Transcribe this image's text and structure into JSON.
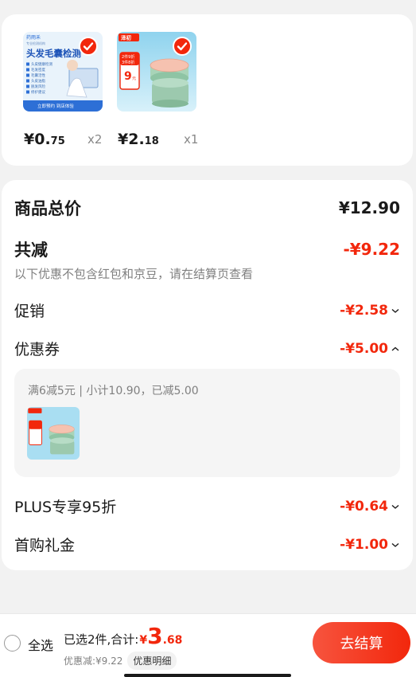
{
  "products": [
    {
      "image_text": {
        "brand": "药雨禾",
        "sub": "专业检测机构",
        "headline": "头发毛囊检测",
        "bullets": [
          "头皮健康检测",
          "毛发密度",
          "毛囊活性",
          "头皮油脂",
          "脱发风险",
          "修护建议"
        ],
        "footer": "立即预约 到店体验"
      },
      "price_int": "¥0.",
      "price_dec": "75",
      "qty": "x2"
    },
    {
      "image_text": {
        "brand": "泽初",
        "promo_top": "2件9折",
        "promo_mid": "3件8折",
        "promo_big": "9",
        "promo_unit": "元"
      },
      "price_int": "¥2.",
      "price_dec": "18",
      "qty": "x1"
    }
  ],
  "summary": {
    "goods_total_label": "商品总价",
    "goods_total_value": "¥12.90",
    "reduce_label": "共减",
    "reduce_value": "-¥9.22",
    "reduce_note": "以下优惠不包含红包和京豆，请在结算页查看",
    "promo_label": "促销",
    "promo_value": "-¥2.58",
    "coupon_label": "优惠券",
    "coupon_value": "-¥5.00",
    "coupon_detail": "满6减5元 | 小计10.90，已减5.00",
    "plus_label": "PLUS专享95折",
    "plus_value": "-¥0.64",
    "first_label": "首购礼金",
    "first_value": "-¥1.00"
  },
  "bottom": {
    "select_all": "全选",
    "selected_text": "已选2件,合计:",
    "total_yen": "¥",
    "total_int": "3",
    "total_dec": ".68",
    "discount_text": "优惠减:¥9.22",
    "detail_label": "优惠明细",
    "checkout_label": "去结算"
  },
  "colors": {
    "accent": "#f2270c",
    "mint": "#9cc9ae",
    "sky": "#8fd3ee"
  }
}
